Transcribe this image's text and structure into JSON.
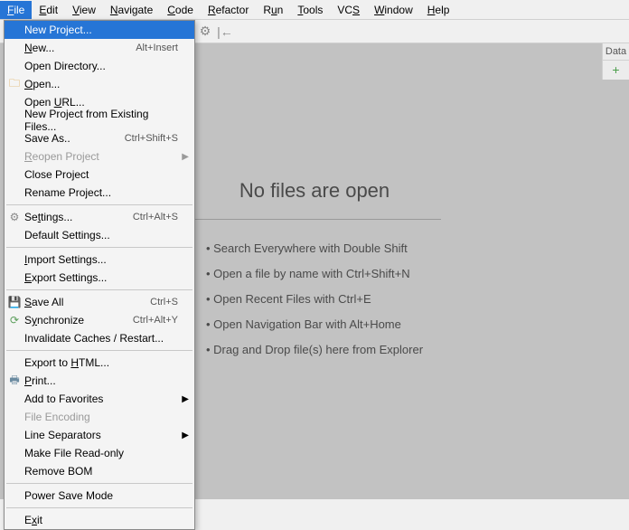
{
  "menubar": {
    "file": "File",
    "edit": "Edit",
    "view": "View",
    "navigate": "Navigate",
    "code": "Code",
    "refactor": "Refactor",
    "run": "Run",
    "tools": "Tools",
    "vcs": "VCS",
    "window": "Window",
    "help": "Help"
  },
  "file_menu": {
    "new_project": "New Project...",
    "new": "New...",
    "new_shortcut": "Alt+Insert",
    "open_directory": "Open Directory...",
    "open": "Open...",
    "open_url": "Open URL...",
    "new_from_existing": "New Project from Existing Files...",
    "save_as": "Save As..",
    "save_as_shortcut": "Ctrl+Shift+S",
    "reopen_project": "Reopen Project",
    "close_project": "Close Project",
    "rename_project": "Rename Project...",
    "settings": "Settings...",
    "settings_shortcut": "Ctrl+Alt+S",
    "default_settings": "Default Settings...",
    "import_settings": "Import Settings...",
    "export_settings": "Export Settings...",
    "save_all": "Save All",
    "save_all_shortcut": "Ctrl+S",
    "synchronize": "Synchronize",
    "synchronize_shortcut": "Ctrl+Alt+Y",
    "invalidate_caches": "Invalidate Caches / Restart...",
    "export_html": "Export to HTML...",
    "print": "Print...",
    "add_favorites": "Add to Favorites",
    "file_encoding": "File Encoding",
    "line_separators": "Line Separators",
    "make_readonly": "Make File Read-only",
    "remove_bom": "Remove BOM",
    "power_save": "Power Save Mode",
    "exit": "Exit"
  },
  "empty_state": {
    "title": "No files are open",
    "hint1": "Search Everywhere with Double Shift",
    "hint2": "Open a file by name with Ctrl+Shift+N",
    "hint3": "Open Recent Files with Ctrl+E",
    "hint4": "Open Navigation Bar with Alt+Home",
    "hint5": "Drag and Drop file(s) here from Explorer"
  },
  "right_panel": {
    "tab1": "Data"
  }
}
